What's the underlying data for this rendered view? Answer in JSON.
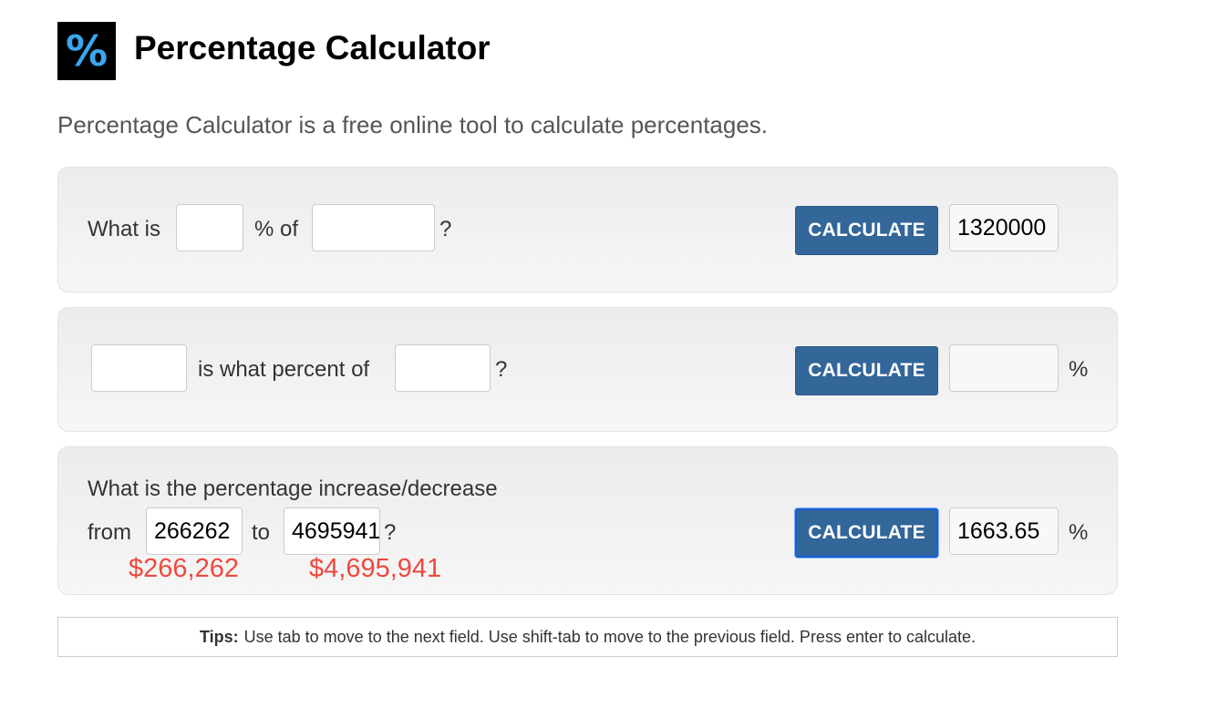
{
  "header": {
    "logo_symbol": "%",
    "title": "Percentage Calculator",
    "subtitle": "Percentage Calculator is a free online tool to calculate percentages."
  },
  "calc1": {
    "label_what_is": "What is",
    "label_percent_of": "% of",
    "label_question": "?",
    "percent_value": "",
    "base_value": "",
    "button_label": "CALCULATE",
    "result_value": "1320000"
  },
  "calc2": {
    "part_value": "",
    "label_is_what_percent_of": "is what percent of",
    "whole_value": "",
    "label_question": "?",
    "button_label": "CALCULATE",
    "result_value": "",
    "result_unit": "%"
  },
  "calc3": {
    "label_heading": "What is the percentage increase/decrease",
    "label_from": "from",
    "from_value": "266262",
    "label_to": "to",
    "to_value": "4695941",
    "label_question": "?",
    "from_money": "$266,262",
    "to_money": "$4,695,941",
    "button_label": "CALCULATE",
    "result_value": "1663.65",
    "result_unit": "%"
  },
  "tips": {
    "label": "Tips:",
    "text": "Use tab to move to the next field. Use shift-tab to move to the previous field. Press enter to calculate."
  },
  "colors": {
    "button": "#336699",
    "money": "#f0483e",
    "logo_bg": "#000000",
    "logo_fg": "#3aa6ee"
  }
}
